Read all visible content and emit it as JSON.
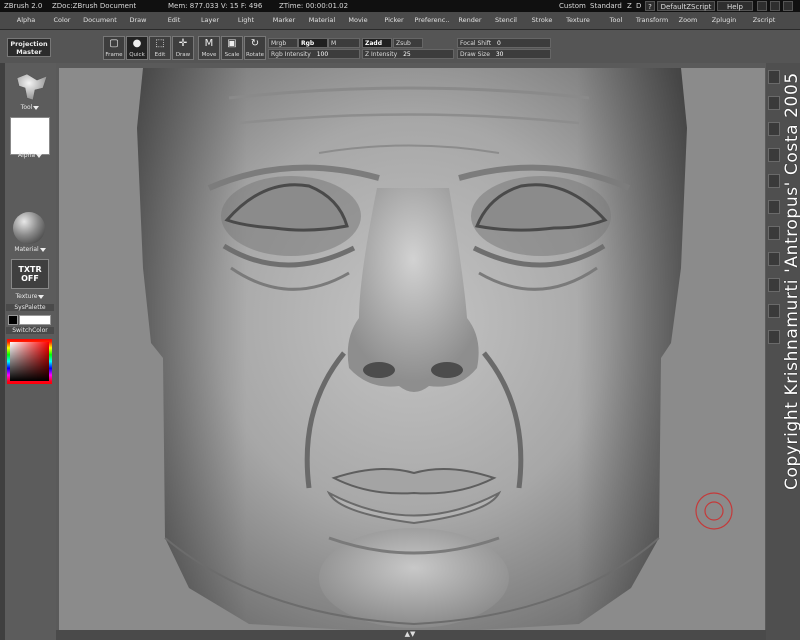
{
  "titlebar": {
    "app": "ZBrush 2.0",
    "doc": "ZDoc:ZBrush Document",
    "mem": "Mem: 877.033  V: 15  F: 496",
    "ztime": "ZTime: 00:00:01.02",
    "custom_label": "Custom",
    "standard_label": "Standard",
    "z_label": "Z",
    "d_label": "D",
    "q_label": "?",
    "script": "DefaultZScript",
    "help": "Help"
  },
  "menu": [
    "Alpha",
    "Color",
    "Document",
    "Draw",
    "Edit",
    "Layer",
    "Light",
    "Marker",
    "Material",
    "Movie",
    "Picker",
    "Preferenc..",
    "Render",
    "Stencil",
    "Stroke",
    "Texture",
    "Tool",
    "Transform",
    "Zoom",
    "Zplugin",
    "Zscript"
  ],
  "toolbar": {
    "projection_master": [
      "Projection",
      "Master"
    ],
    "buttons": [
      {
        "label": "Frame",
        "icon": "▢",
        "on": false
      },
      {
        "label": "Quick",
        "icon": "●",
        "on": true
      },
      {
        "label": "Edit",
        "icon": "⬚",
        "on": false
      },
      {
        "label": "Draw",
        "icon": "✛",
        "on": false
      },
      {
        "label": "Move",
        "icon": "M",
        "on": false
      },
      {
        "label": "Scale",
        "icon": "▣",
        "on": false
      },
      {
        "label": "Rotate",
        "icon": "↻",
        "on": false
      }
    ],
    "mrgb": "Mrgb",
    "rgb": "Rgb",
    "m": "M",
    "rgb_intensity_label": "Rgb Intensity",
    "rgb_intensity_value": "100",
    "zadd": "Zadd",
    "zsub": "Zsub",
    "z_intensity_label": "Z Intensity",
    "z_intensity_value": "25",
    "focal_shift_label": "Focal Shift",
    "focal_shift_value": "0",
    "draw_size_label": "Draw Size",
    "draw_size_value": "30"
  },
  "left_tray": {
    "tool": "Tool",
    "alpha": "Alpha",
    "material": "Material",
    "texture_button": [
      "TXTR",
      "OFF"
    ],
    "texture": "Texture",
    "syspalette": "SysPalette",
    "switchcolor": "SwitchColor"
  },
  "copyright": "Copyright Krishnamurti 'Antropus' Costa 2005"
}
